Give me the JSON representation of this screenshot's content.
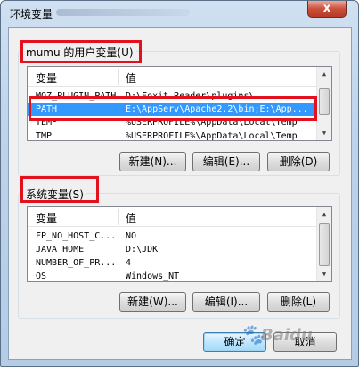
{
  "window": {
    "title": "环境变量",
    "close_symbol": "x"
  },
  "user_vars": {
    "group_label": "mumu 的用户变量(U)",
    "columns": [
      "变量",
      "值"
    ],
    "rows": [
      {
        "name": "MOZ_PLUGIN_PATH",
        "value": "D:\\Foxit Reader\\plugins\\"
      },
      {
        "name": "PATH",
        "value": "E:\\AppServ\\Apache2.2\\bin;E:\\App..."
      },
      {
        "name": "TEMP",
        "value": "%USERPROFILE%\\AppData\\Local\\Temp"
      },
      {
        "name": "TMP",
        "value": "%USERPROFILE%\\AppData\\Local\\Temp"
      }
    ],
    "selected_index": 1,
    "buttons": {
      "new": "新建(N)...",
      "edit": "编辑(E)...",
      "delete": "删除(D)"
    }
  },
  "system_vars": {
    "group_label": "系统变量(S)",
    "columns": [
      "变量",
      "值"
    ],
    "rows": [
      {
        "name": "FP_NO_HOST_C...",
        "value": "NO"
      },
      {
        "name": "JAVA_HOME",
        "value": "D:\\JDK"
      },
      {
        "name": "NUMBER_OF_PR...",
        "value": "4"
      },
      {
        "name": "OS",
        "value": "Windows_NT"
      }
    ],
    "buttons": {
      "new": "新建(W)...",
      "edit": "编辑(I)...",
      "delete": "删除(L)"
    }
  },
  "dialog_buttons": {
    "ok": "确定",
    "cancel": "取消"
  },
  "watermark": {
    "text": "Baidu",
    "paw": "🐾"
  },
  "colors": {
    "highlight": "#e3101e",
    "selection": "#3399ff"
  }
}
